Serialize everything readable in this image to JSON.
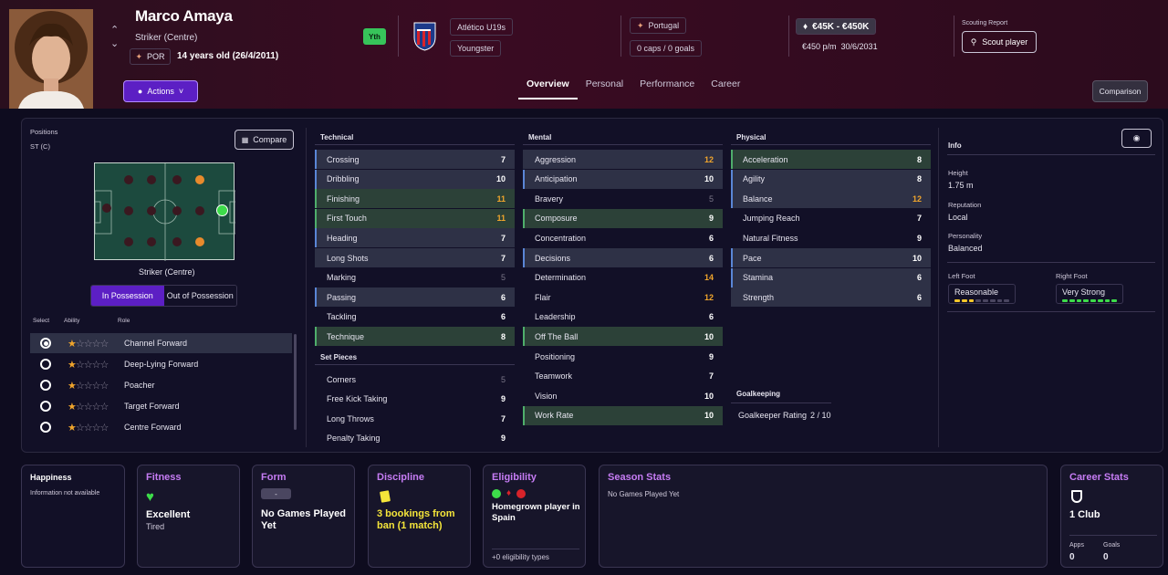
{
  "player": {
    "name": "Marco Amaya",
    "position": "Striker (Centre)",
    "nation_code": "POR",
    "age": "14 years old (26/4/2011)",
    "badge": "Yth",
    "club": "Atlético U19s",
    "status": "Youngster",
    "nation": "Portugal",
    "caps": "0 caps / 0 goals",
    "value": "€45K - €450K",
    "wage": "€450 p/m",
    "contract": "30/6/2031"
  },
  "header": {
    "actions_label": "Actions",
    "scouting_label": "Scouting Report",
    "scout_button": "Scout player",
    "comparison_button": "Comparison"
  },
  "tabs": [
    "Overview",
    "Personal",
    "Performance",
    "Career"
  ],
  "positions": {
    "title": "Positions",
    "value": "ST (C)",
    "compare_button": "Compare",
    "pitch_label": "Striker (Centre)",
    "toggle": [
      "In Possession",
      "Out of Possession"
    ],
    "col_select": "Select",
    "col_ability": "Ability",
    "col_role": "Role",
    "roles": [
      "Channel Forward",
      "Deep-Lying Forward",
      "Poacher",
      "Target Forward",
      "Centre Forward"
    ]
  },
  "technical": {
    "title": "Technical",
    "rows": [
      {
        "name": "Crossing",
        "value": "7",
        "style": "w",
        "hl": "blue"
      },
      {
        "name": "Dribbling",
        "value": "10",
        "style": "w",
        "hl": "blue"
      },
      {
        "name": "Finishing",
        "value": "11",
        "style": "o",
        "hl": "green"
      },
      {
        "name": "First Touch",
        "value": "11",
        "style": "o",
        "hl": "green"
      },
      {
        "name": "Heading",
        "value": "7",
        "style": "w",
        "hl": "blue"
      },
      {
        "name": "Long Shots",
        "value": "7",
        "style": "w",
        "hl": "plain"
      },
      {
        "name": "Marking",
        "value": "5",
        "style": "g",
        "hl": "none"
      },
      {
        "name": "Passing",
        "value": "6",
        "style": "w",
        "hl": "blue"
      },
      {
        "name": "Tackling",
        "value": "6",
        "style": "w",
        "hl": "none"
      },
      {
        "name": "Technique",
        "value": "8",
        "style": "w",
        "hl": "green"
      }
    ]
  },
  "set_pieces": {
    "title": "Set Pieces",
    "rows": [
      {
        "name": "Corners",
        "value": "5",
        "style": "g",
        "hl": "none"
      },
      {
        "name": "Free Kick Taking",
        "value": "9",
        "style": "w",
        "hl": "none"
      },
      {
        "name": "Long Throws",
        "value": "7",
        "style": "w",
        "hl": "none"
      },
      {
        "name": "Penalty Taking",
        "value": "9",
        "style": "w",
        "hl": "none"
      }
    ]
  },
  "mental": {
    "title": "Mental",
    "rows": [
      {
        "name": "Aggression",
        "value": "12",
        "style": "o",
        "hl": "plain"
      },
      {
        "name": "Anticipation",
        "value": "10",
        "style": "w",
        "hl": "blue"
      },
      {
        "name": "Bravery",
        "value": "5",
        "style": "g",
        "hl": "none"
      },
      {
        "name": "Composure",
        "value": "9",
        "style": "w",
        "hl": "green"
      },
      {
        "name": "Concentration",
        "value": "6",
        "style": "w",
        "hl": "none"
      },
      {
        "name": "Decisions",
        "value": "6",
        "style": "w",
        "hl": "blue"
      },
      {
        "name": "Determination",
        "value": "14",
        "style": "o",
        "hl": "none"
      },
      {
        "name": "Flair",
        "value": "12",
        "style": "o",
        "hl": "none"
      },
      {
        "name": "Leadership",
        "value": "6",
        "style": "w",
        "hl": "none"
      },
      {
        "name": "Off The Ball",
        "value": "10",
        "style": "w",
        "hl": "green"
      },
      {
        "name": "Positioning",
        "value": "9",
        "style": "w",
        "hl": "none"
      },
      {
        "name": "Teamwork",
        "value": "7",
        "style": "w",
        "hl": "none"
      },
      {
        "name": "Vision",
        "value": "10",
        "style": "w",
        "hl": "none"
      },
      {
        "name": "Work Rate",
        "value": "10",
        "style": "w",
        "hl": "green"
      }
    ]
  },
  "physical": {
    "title": "Physical",
    "rows": [
      {
        "name": "Acceleration",
        "value": "8",
        "style": "w",
        "hl": "green"
      },
      {
        "name": "Agility",
        "value": "8",
        "style": "w",
        "hl": "blue"
      },
      {
        "name": "Balance",
        "value": "12",
        "style": "o",
        "hl": "blue"
      },
      {
        "name": "Jumping Reach",
        "value": "7",
        "style": "w",
        "hl": "none"
      },
      {
        "name": "Natural Fitness",
        "value": "9",
        "style": "w",
        "hl": "none"
      },
      {
        "name": "Pace",
        "value": "10",
        "style": "w",
        "hl": "blue"
      },
      {
        "name": "Stamina",
        "value": "6",
        "style": "w",
        "hl": "blue"
      },
      {
        "name": "Strength",
        "value": "6",
        "style": "w",
        "hl": "plain"
      }
    ]
  },
  "goalkeeping": {
    "title": "Goalkeeping",
    "rating_label": "Goalkeeper Rating",
    "rating_value": "2 / 10"
  },
  "info": {
    "title": "Info",
    "height_label": "Height",
    "height": "1.75 m",
    "reputation_label": "Reputation",
    "reputation": "Local",
    "personality_label": "Personality",
    "personality": "Balanced",
    "left_foot_label": "Left Foot",
    "left_foot": "Reasonable",
    "left_foot_level": 3,
    "right_foot_label": "Right Foot",
    "right_foot": "Very Strong",
    "right_foot_level": 5
  },
  "cards": {
    "happiness_title": "Happiness",
    "happiness_text": "Information not available",
    "fitness_title": "Fitness",
    "fitness_value": "Excellent",
    "fitness_sub": "Tired",
    "form_title": "Form",
    "form_badge": "-",
    "form_text": "No Games Played Yet",
    "discipline_title": "Discipline",
    "discipline_text": "3 bookings from ban (1 match)",
    "eligibility_title": "Eligibility",
    "eligibility_text": "Homegrown player in Spain",
    "eligibility_link": "+0 eligibility types",
    "season_title": "Season Stats",
    "season_text": "No Games Played Yet",
    "career_title": "Career Stats",
    "career_clubs": "1 Club",
    "apps_label": "Apps",
    "apps": "0",
    "goals_label": "Goals",
    "goals": "0"
  },
  "colors": {
    "accent_purple": "#5c1fc4",
    "highlight_orange": "#f0a52c",
    "positive_green": "#37c45a",
    "card_title": "#c67cf4"
  }
}
